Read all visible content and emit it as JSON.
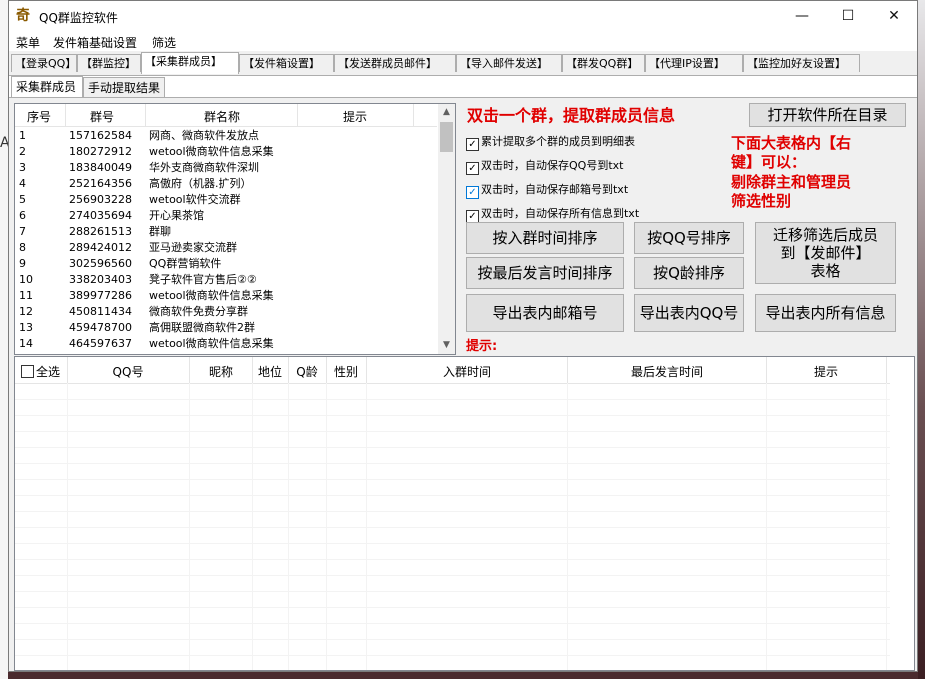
{
  "window": {
    "icon_glyph": "奇",
    "title": "QQ群监控软件",
    "controls": {
      "minimize": "—",
      "maximize": "☐",
      "close": "✕"
    }
  },
  "menu": [
    "菜单",
    "发件箱基础设置",
    "筛选"
  ],
  "tabs": [
    "【登录QQ】",
    "【群监控】",
    "【采集群成员】",
    "【发件箱设置】",
    "【发送群成员邮件】",
    "【导入邮件发送】",
    "【群发QQ群】",
    "【代理IP设置】",
    "【监控加好友设置】"
  ],
  "subtabs": [
    "采集群成员",
    "手动提取结果"
  ],
  "group_list": {
    "columns": [
      "序号",
      "群号",
      "群名称",
      "提示"
    ],
    "rows": [
      [
        "1",
        "157162584",
        "网商、微商软件发放点",
        ""
      ],
      [
        "2",
        "180272912",
        "wetool微商软件信息采集",
        ""
      ],
      [
        "3",
        "183840049",
        "华外支商微商软件深圳",
        ""
      ],
      [
        "4",
        "252164356",
        "高傲府（机器.扩列）",
        ""
      ],
      [
        "5",
        "256903228",
        "wetool软件交流群",
        ""
      ],
      [
        "6",
        "274035694",
        "开心果茶馆",
        ""
      ],
      [
        "7",
        "288261513",
        "群聊",
        ""
      ],
      [
        "8",
        "289424012",
        "亚马逊卖家交流群",
        ""
      ],
      [
        "9",
        "302596560",
        "QQ群营销软件",
        ""
      ],
      [
        "10",
        "338203403",
        "凳子软件官方售后②②",
        ""
      ],
      [
        "11",
        "389977286",
        "wetool微商软件信息采集",
        ""
      ],
      [
        "12",
        "450811434",
        "微商软件免费分享群",
        ""
      ],
      [
        "13",
        "459478700",
        "高佣联盟微商软件2群",
        ""
      ],
      [
        "14",
        "464597637",
        "wetool微商软件信息采集",
        ""
      ]
    ]
  },
  "headline": "双击一个群，提取群成员信息",
  "open_dir_button": "打开软件所在目录",
  "checkboxes": [
    {
      "label": "累计提取多个群的成员到明细表",
      "checked": true
    },
    {
      "label": "双击时，自动保存QQ号到txt",
      "checked": true
    },
    {
      "label": "双击时，自动保存邮箱号到txt",
      "checked": true
    },
    {
      "label": "双击时，自动保存所有信息到txt",
      "checked": true
    }
  ],
  "side_note": [
    "下面大表格内【右",
    "键】可以：",
    "剔除群主和管理员",
    "筛选性别"
  ],
  "buttons": {
    "sort_join_time": "按入群时间排序",
    "sort_qq": "按QQ号排序",
    "migrate": [
      "迁移筛选后成员",
      "到【发邮件】",
      "表格"
    ],
    "sort_last_speak": "按最后发言时间排序",
    "sort_qage": "按Q龄排序",
    "export_mail": "导出表内邮箱号",
    "export_qq": "导出表内QQ号",
    "export_all": "导出表内所有信息"
  },
  "hint_label": "提示:",
  "member_table": {
    "select_all": "全选",
    "columns": [
      "QQ号",
      "昵称",
      "地位",
      "Q龄",
      "性别",
      "入群时间",
      "最后发言时间",
      "提示"
    ]
  },
  "background_letter": "A"
}
